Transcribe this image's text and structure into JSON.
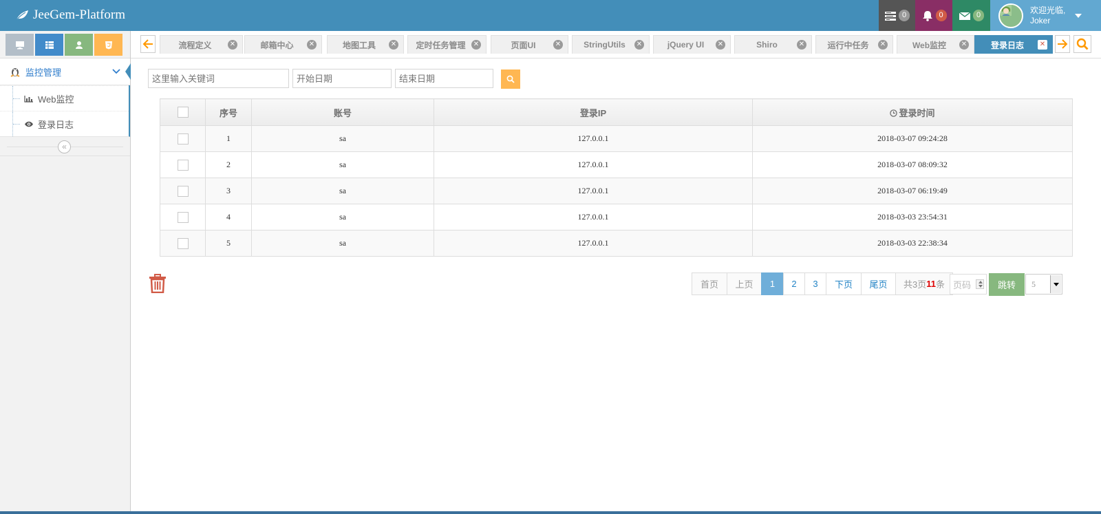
{
  "header": {
    "brand": "JeeGem-Platform",
    "tasks_count": "0",
    "notifications_count": "0",
    "messages_count": "0",
    "welcome": "欢迎光临,",
    "username": "Joker"
  },
  "sidebar": {
    "menu_title": "监控管理",
    "items": [
      {
        "label": "Web监控",
        "icon": "bar-chart-icon"
      },
      {
        "label": "登录日志",
        "icon": "eye-icon"
      }
    ]
  },
  "tabs": [
    {
      "label": "流程定义"
    },
    {
      "label": "邮箱中心"
    },
    {
      "label": "地图工具"
    },
    {
      "label": "定时任务管理"
    },
    {
      "label": "页面UI"
    },
    {
      "label": "StringUtils"
    },
    {
      "label": "jQuery UI"
    },
    {
      "label": "Shiro"
    },
    {
      "label": "运行中任务"
    },
    {
      "label": "Web监控"
    },
    {
      "label": "登录日志",
      "active": true
    }
  ],
  "filters": {
    "keyword_placeholder": "这里输入关键词",
    "start_placeholder": "开始日期",
    "end_placeholder": "结束日期"
  },
  "table": {
    "headers": [
      "序号",
      "账号",
      "登录IP",
      "登录时间"
    ],
    "rows": [
      {
        "no": "1",
        "account": "sa",
        "ip": "127.0.0.1",
        "time": "2018-03-07 09:24:28"
      },
      {
        "no": "2",
        "account": "sa",
        "ip": "127.0.0.1",
        "time": "2018-03-07 08:09:32"
      },
      {
        "no": "3",
        "account": "sa",
        "ip": "127.0.0.1",
        "time": "2018-03-07 06:19:49"
      },
      {
        "no": "4",
        "account": "sa",
        "ip": "127.0.0.1",
        "time": "2018-03-03 23:54:31"
      },
      {
        "no": "5",
        "account": "sa",
        "ip": "127.0.0.1",
        "time": "2018-03-03 22:38:34"
      }
    ]
  },
  "pager": {
    "first": "首页",
    "prev": "上页",
    "pages": [
      "1",
      "2",
      "3"
    ],
    "current": "1",
    "next": "下页",
    "last": "尾页",
    "total_prefix": "共3页",
    "total_count": "11",
    "total_suffix": "条",
    "page_input_placeholder": "页码",
    "go": "跳转",
    "page_size": "5"
  },
  "colors": {
    "navbar": "#438eb9",
    "active_tab": "#438eb9",
    "accent_orange": "#ffb752",
    "go_green": "#87b87f",
    "current_page": "#6faed9",
    "trash": "#d15b47"
  }
}
